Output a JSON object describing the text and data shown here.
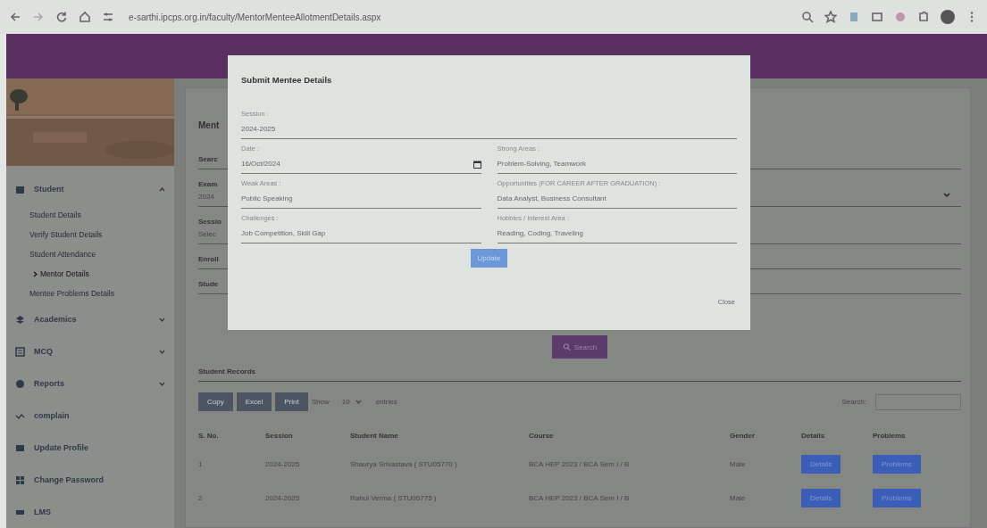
{
  "browser": {
    "url": "e-sarthi.ipcps.org.in/faculty/MentorMenteeAllotmentDetails.aspx"
  },
  "sidebar": {
    "items": [
      {
        "label": "Student",
        "kind": "section",
        "expanded": true,
        "children": [
          {
            "label": "Student Details",
            "selected": false
          },
          {
            "label": "Verify Student Details",
            "selected": false
          },
          {
            "label": "Student Attendance",
            "selected": false
          },
          {
            "label": "Mentor Details",
            "selected": true
          },
          {
            "label": "Mentee Problems Details",
            "selected": false
          }
        ]
      },
      {
        "label": "Academics",
        "kind": "section",
        "expanded": false
      },
      {
        "label": "MCQ",
        "kind": "section",
        "expanded": false
      },
      {
        "label": "Reports",
        "kind": "section",
        "expanded": false
      },
      {
        "label": "complain",
        "kind": "link"
      },
      {
        "label": "Update Profile",
        "kind": "link"
      },
      {
        "label": "Change Password",
        "kind": "link"
      },
      {
        "label": "LMS",
        "kind": "link"
      }
    ]
  },
  "form": {
    "title": "Ment",
    "fields": [
      {
        "label": "Searc"
      },
      {
        "label": "Exam",
        "value": "2024",
        "kind": "select"
      },
      {
        "label": "Sessio",
        "value": "Selec"
      },
      {
        "label": "Enroll"
      },
      {
        "label": "Stude"
      }
    ],
    "search_button": "Search"
  },
  "records": {
    "title": "Student Records",
    "buttons": [
      "Copy",
      "Excel",
      "Print"
    ],
    "show": "Show",
    "page_size": "10",
    "entries": "entries",
    "search_label": "Search:",
    "columns": [
      "S. No.",
      "Session",
      "Student Name",
      "Course",
      "Gender",
      "Details",
      "Problems"
    ],
    "rows": [
      {
        "no": "1",
        "session": "2024-2025",
        "name": "Shaurya Srivastava ( STU05770 )",
        "course": "BCA HEP 2023 / BCA Sem I / B",
        "gender": "Male",
        "details": "Details",
        "problems": "Problems"
      },
      {
        "no": "2",
        "session": "2024-2025",
        "name": "Rahul Verma ( STU05775 )",
        "course": "BCA HEP 2023 / BCA Sem I / B",
        "gender": "Male",
        "details": "Details",
        "problems": "Problems"
      }
    ]
  },
  "modal": {
    "title": "Submit Mentee Details",
    "session": {
      "label": "Session :",
      "value": "2024-2025"
    },
    "left": [
      {
        "label": "Date :",
        "value": "16/Oct/2024",
        "kind": "date"
      },
      {
        "label": "Weak Areas :",
        "value": "Public Speaking"
      },
      {
        "label": "Challenges :",
        "value": "Job Competition, Skill Gap"
      }
    ],
    "right": [
      {
        "label": "Strong Areas :",
        "value": "Problem-Solving, Teamwork"
      },
      {
        "label": "Opportunities (FOR CAREER AFTER GRADUATION) :",
        "value": "Data Analyst, Business Consultant"
      },
      {
        "label": "Hobbies / Interest Area :",
        "value": "Reading, Coding, Traveling"
      }
    ],
    "update_button": "Update",
    "close_button": "Close"
  }
}
